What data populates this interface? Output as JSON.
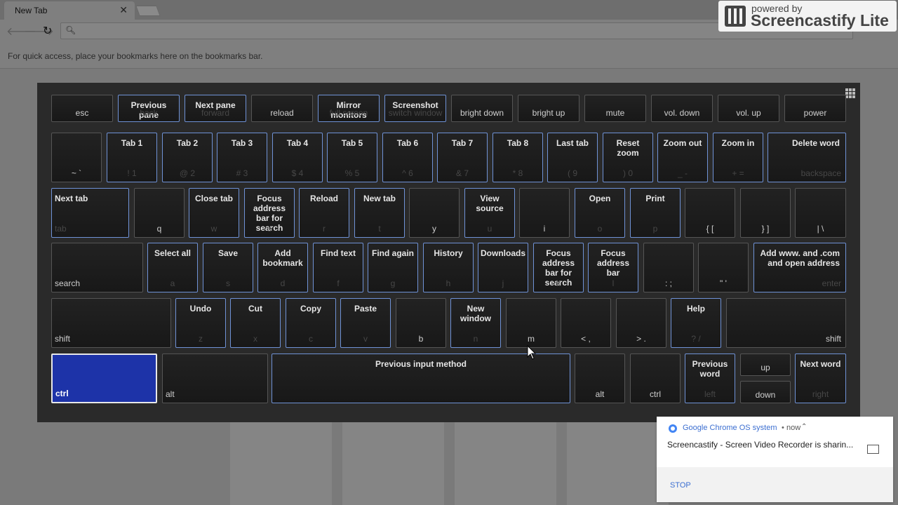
{
  "browser": {
    "tab_title": "New Tab",
    "tab_close": "✕",
    "back_icon": "🡐",
    "forward_icon": "🡒",
    "reload_icon": "↻",
    "bookmarks_hint": "For quick access, place your bookmarks here on the bookmarks bar."
  },
  "screencastify": {
    "powered_by": "powered by",
    "brand": "Screencastify Lite"
  },
  "keyboard": {
    "row1": [
      {
        "top": "",
        "bottom": "esc",
        "hl": false
      },
      {
        "top": "Previous pane",
        "bottom": "back",
        "hl": true
      },
      {
        "top": "Next pane",
        "bottom": "forward",
        "hl": true
      },
      {
        "top": "",
        "bottom": "reload",
        "hl": false
      },
      {
        "top": "Mirror monitors",
        "bottom": "full screen",
        "hl": true
      },
      {
        "top": "Screenshot",
        "bottom": "switch window",
        "hl": true
      },
      {
        "top": "",
        "bottom": "bright down",
        "hl": false
      },
      {
        "top": "",
        "bottom": "bright up",
        "hl": false
      },
      {
        "top": "",
        "bottom": "mute",
        "hl": false
      },
      {
        "top": "",
        "bottom": "vol. down",
        "hl": false
      },
      {
        "top": "",
        "bottom": "vol. up",
        "hl": false
      },
      {
        "top": "",
        "bottom": "power",
        "hl": false
      }
    ],
    "row2": [
      {
        "top": "",
        "bottom": "~ `",
        "hl": false
      },
      {
        "top": "Tab 1",
        "bottom": "! 1",
        "hl": true
      },
      {
        "top": "Tab 2",
        "bottom": "@ 2",
        "hl": true
      },
      {
        "top": "Tab 3",
        "bottom": "# 3",
        "hl": true
      },
      {
        "top": "Tab 4",
        "bottom": "$ 4",
        "hl": true
      },
      {
        "top": "Tab 5",
        "bottom": "% 5",
        "hl": true
      },
      {
        "top": "Tab 6",
        "bottom": "^ 6",
        "hl": true
      },
      {
        "top": "Tab 7",
        "bottom": "& 7",
        "hl": true
      },
      {
        "top": "Tab 8",
        "bottom": "* 8",
        "hl": true
      },
      {
        "top": "Last tab",
        "bottom": "( 9",
        "hl": true
      },
      {
        "top": "Reset zoom",
        "bottom": ") 0",
        "hl": true
      },
      {
        "top": "Zoom out",
        "bottom": "_ -",
        "hl": true
      },
      {
        "top": "Zoom in",
        "bottom": "+ =",
        "hl": true
      },
      {
        "top": "Delete word",
        "bottom": "backspace",
        "hl": true,
        "align": "r"
      }
    ],
    "row3": [
      {
        "top": "Next tab",
        "bottom": "tab",
        "hl": true,
        "align": "l"
      },
      {
        "top": "",
        "bottom": "q",
        "hl": false
      },
      {
        "top": "Close tab",
        "bottom": "w",
        "hl": true
      },
      {
        "top": "Focus address bar for search",
        "bottom": "e",
        "hl": true
      },
      {
        "top": "Reload",
        "bottom": "r",
        "hl": true
      },
      {
        "top": "New tab",
        "bottom": "t",
        "hl": true
      },
      {
        "top": "",
        "bottom": "y",
        "hl": false
      },
      {
        "top": "View source",
        "bottom": "u",
        "hl": true
      },
      {
        "top": "",
        "bottom": "i",
        "hl": false
      },
      {
        "top": "Open",
        "bottom": "o",
        "hl": true
      },
      {
        "top": "Print",
        "bottom": "p",
        "hl": true
      },
      {
        "top": "",
        "bottom": "{ [",
        "hl": false
      },
      {
        "top": "",
        "bottom": "} ]",
        "hl": false
      },
      {
        "top": "",
        "bottom": "| \\",
        "hl": false
      }
    ],
    "row4": [
      {
        "top": "",
        "bottom": "search",
        "hl": false,
        "align": "l"
      },
      {
        "top": "Select all",
        "bottom": "a",
        "hl": true
      },
      {
        "top": "Save",
        "bottom": "s",
        "hl": true
      },
      {
        "top": "Add bookmark",
        "bottom": "d",
        "hl": true
      },
      {
        "top": "Find text",
        "bottom": "f",
        "hl": true
      },
      {
        "top": "Find again",
        "bottom": "g",
        "hl": true
      },
      {
        "top": "History",
        "bottom": "h",
        "hl": true
      },
      {
        "top": "Downloads",
        "bottom": "j",
        "hl": true
      },
      {
        "top": "Focus address bar for search",
        "bottom": "k",
        "hl": true
      },
      {
        "top": "Focus address bar",
        "bottom": "l",
        "hl": true
      },
      {
        "top": "",
        "bottom": ": ;",
        "hl": false
      },
      {
        "top": "",
        "bottom": "\" '",
        "hl": false
      },
      {
        "top": "Add www. and .com and open address",
        "bottom": "enter",
        "hl": true,
        "align": "r"
      }
    ],
    "row5": [
      {
        "top": "",
        "bottom": "shift",
        "hl": false,
        "align": "l"
      },
      {
        "top": "Undo",
        "bottom": "z",
        "hl": true
      },
      {
        "top": "Cut",
        "bottom": "x",
        "hl": true
      },
      {
        "top": "Copy",
        "bottom": "c",
        "hl": true
      },
      {
        "top": "Paste",
        "bottom": "v",
        "hl": true
      },
      {
        "top": "",
        "bottom": "b",
        "hl": false
      },
      {
        "top": "New window",
        "bottom": "n",
        "hl": true
      },
      {
        "top": "",
        "bottom": "m",
        "hl": false
      },
      {
        "top": "",
        "bottom": "< ,",
        "hl": false
      },
      {
        "top": "",
        "bottom": "> .",
        "hl": false
      },
      {
        "top": "Help",
        "bottom": "? /",
        "hl": true
      },
      {
        "top": "",
        "bottom": "shift",
        "hl": false,
        "align": "r"
      }
    ],
    "row6": [
      {
        "top": "",
        "bottom": "ctrl",
        "hl": false,
        "pressed": true,
        "align": "l"
      },
      {
        "top": "",
        "bottom": "alt",
        "hl": false,
        "align": "l"
      },
      {
        "top": "Previous input method",
        "bottom": "",
        "hl": true
      },
      {
        "top": "",
        "bottom": "alt",
        "hl": false
      },
      {
        "top": "",
        "bottom": "ctrl",
        "hl": false
      },
      {
        "top": "Previous word",
        "bottom": "left",
        "hl": true
      },
      {
        "top": "",
        "bottom": "up",
        "hl": false,
        "half": "top"
      },
      {
        "top": "",
        "bottom": "down",
        "hl": false,
        "half": "bottom"
      },
      {
        "top": "Next word",
        "bottom": "right",
        "hl": true
      }
    ]
  },
  "notification": {
    "source": "Google Chrome OS system",
    "separator": "•",
    "time": "now",
    "expand_icon": "⌃",
    "message": "Screencastify - Screen Video Recorder is sharin...",
    "action": "STOP"
  }
}
